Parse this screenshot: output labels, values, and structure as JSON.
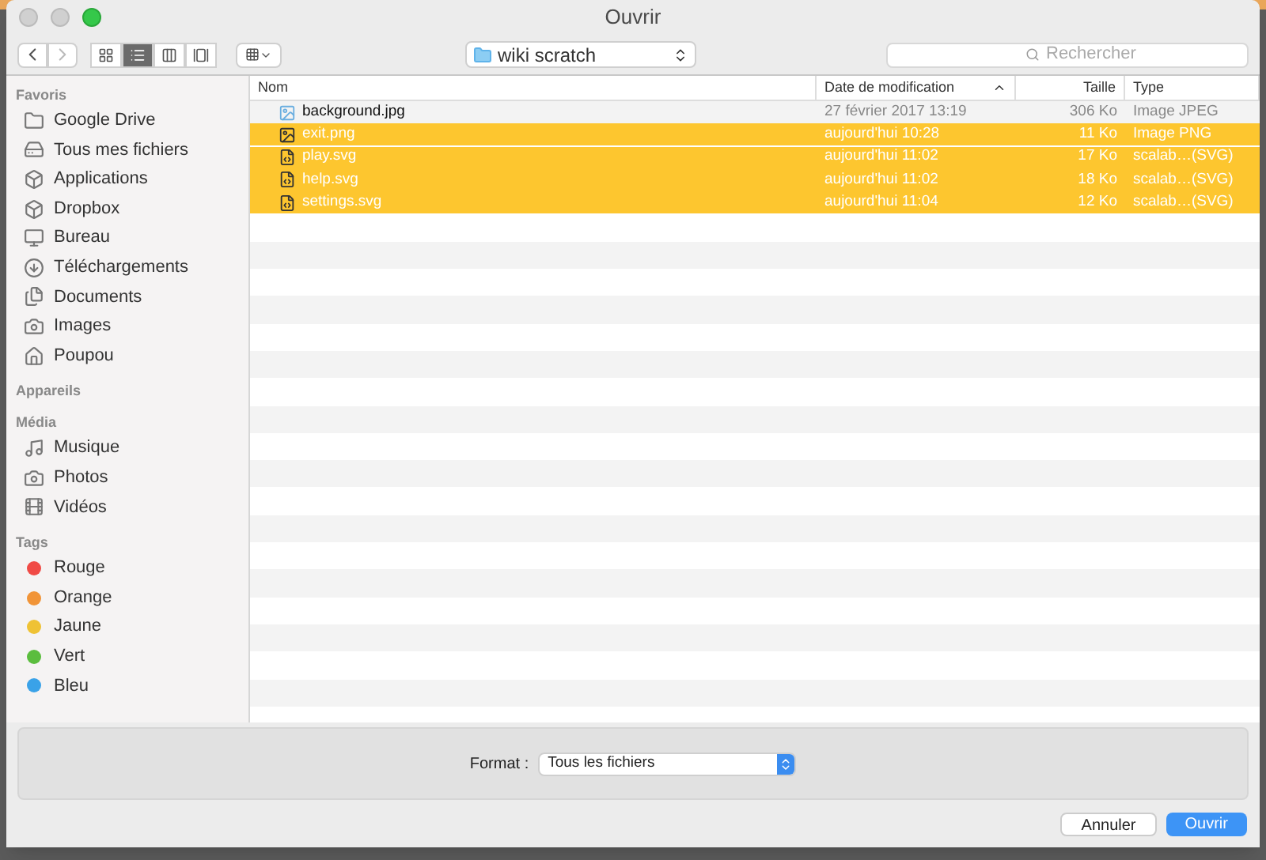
{
  "window": {
    "title": "Ouvrir"
  },
  "toolbar": {
    "views": [
      {
        "kind": "icons",
        "selected": false
      },
      {
        "kind": "list",
        "selected": true
      },
      {
        "kind": "columns",
        "selected": false
      },
      {
        "kind": "coverflow",
        "selected": false
      }
    ],
    "location": "wiki scratch",
    "search": {
      "placeholder": "Rechercher"
    }
  },
  "sidebar": {
    "sections": [
      {
        "title": "Favoris",
        "items": [
          {
            "label": "Google Drive"
          },
          {
            "label": "Tous mes fichiers"
          },
          {
            "label": "Applications"
          },
          {
            "label": "Dropbox"
          },
          {
            "label": "Bureau"
          },
          {
            "label": "Téléchargements"
          },
          {
            "label": "Documents"
          },
          {
            "label": "Images"
          },
          {
            "label": "Poupou"
          }
        ]
      },
      {
        "title": "Appareils"
      },
      {
        "title": "Média",
        "items": [
          {
            "label": "Musique"
          },
          {
            "label": "Photos"
          },
          {
            "label": "Vidéos"
          }
        ]
      },
      {
        "title": "Tags",
        "items": [
          {
            "label": "Rouge",
            "color": "#f04a45"
          },
          {
            "label": "Orange",
            "color": "#f19437"
          },
          {
            "label": "Jaune",
            "color": "#efc234"
          },
          {
            "label": "Vert",
            "color": "#5bbd3e"
          },
          {
            "label": "Bleu",
            "color": "#3aa2e8"
          }
        ]
      }
    ]
  },
  "table": {
    "columns": [
      {
        "label": "Nom"
      },
      {
        "label": "Date de modification",
        "sorted": true
      },
      {
        "label": "Taille"
      },
      {
        "label": "Type"
      }
    ],
    "rows": [
      {
        "name": "background.jpg",
        "kind": "image",
        "date": "27 février 2017 13:19",
        "size": "306 Ko",
        "type": "Image JPEG",
        "selected": false
      },
      {
        "name": "exit.png",
        "kind": "image",
        "date": "aujourd'hui 10:28",
        "size": "11 Ko",
        "type": "Image PNG",
        "selected": true
      },
      {
        "name": "play.svg",
        "kind": "vector",
        "date": "aujourd'hui 11:02",
        "size": "17 Ko",
        "type": "scalab…(SVG)",
        "selected": true
      },
      {
        "name": "help.svg",
        "kind": "vector",
        "date": "aujourd'hui 11:02",
        "size": "18 Ko",
        "type": "scalab…(SVG)",
        "selected": true
      },
      {
        "name": "settings.svg",
        "kind": "vector",
        "date": "aujourd'hui 11:04",
        "size": "12 Ko",
        "type": "scalab…(SVG)",
        "selected": true
      }
    ]
  },
  "format": {
    "label": "Format :",
    "value": "Tous les fichiers"
  },
  "buttons": [
    {
      "label": "Annuler",
      "kind": "secondary"
    },
    {
      "label": "Ouvrir",
      "kind": "primary"
    }
  ]
}
